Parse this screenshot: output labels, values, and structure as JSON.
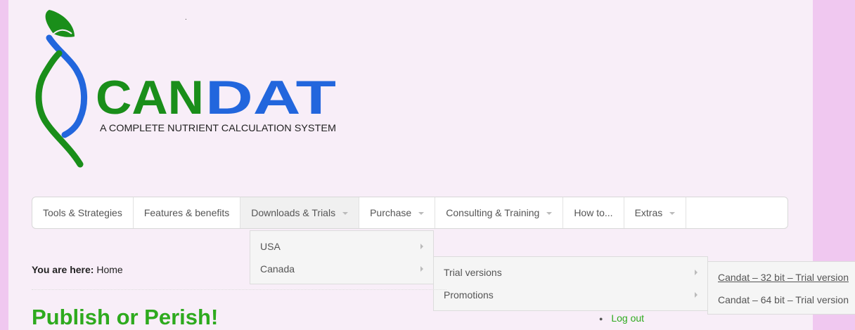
{
  "logo": {
    "brand_left": "CAN",
    "brand_right": "DAT",
    "tagline": "A COMPLETE NUTRIENT CALCULATION SYSTEM",
    "green": "#1a8e1a",
    "blue": "#2266dd"
  },
  "header": {
    "dot": "."
  },
  "nav": {
    "items": [
      {
        "label": "Tools & Strategies"
      },
      {
        "label": "Features & benefits"
      },
      {
        "label": "Downloads & Trials"
      },
      {
        "label": "Purchase"
      },
      {
        "label": "Consulting & Training"
      },
      {
        "label": "How to..."
      },
      {
        "label": "Extras"
      }
    ]
  },
  "dropdown1": {
    "items": [
      {
        "label": "USA"
      },
      {
        "label": "Canada"
      }
    ]
  },
  "dropdown2": {
    "items": [
      {
        "label": "Trial versions"
      },
      {
        "label": "Promotions"
      }
    ]
  },
  "dropdown3": {
    "items": [
      {
        "label": "Candat – 32 bit – Trial version"
      },
      {
        "label": "Candat – 64 bit – Trial version"
      }
    ]
  },
  "breadcrumb": {
    "prefix": "You are here:",
    "current": "Home"
  },
  "main": {
    "title": "Publish or Perish!"
  },
  "sidebar": {
    "logout_label": "Log out"
  },
  "colors": {
    "page_bg": "#f0c8f0",
    "content_bg": "#f8eef8",
    "title_green": "#2eaa1e"
  }
}
